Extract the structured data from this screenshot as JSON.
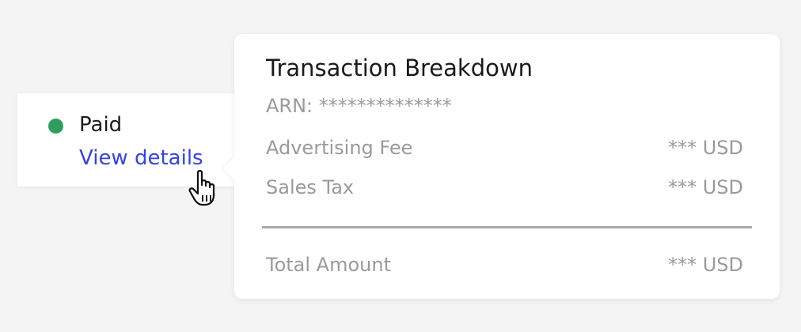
{
  "status": {
    "label": "Paid",
    "color": "#2e9e5e",
    "link": "View details",
    "link_color": "#3343e6"
  },
  "popover": {
    "title": "Transaction Breakdown",
    "arn_label": "ARN:",
    "arn_value": "**************",
    "rows": [
      {
        "label": "Advertising Fee",
        "value": "*** USD"
      },
      {
        "label": "Sales Tax",
        "value": "*** USD"
      }
    ],
    "total": {
      "label": "Total Amount",
      "value": "*** USD"
    }
  },
  "cursor": {
    "icon": "hand-pointer-icon"
  }
}
